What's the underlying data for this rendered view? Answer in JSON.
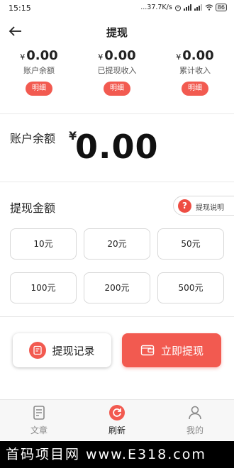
{
  "status_bar": {
    "time": "15:15",
    "network_speed": "...37.7K/s",
    "battery": "86"
  },
  "header": {
    "title": "提现"
  },
  "stats": [
    {
      "currency": "¥",
      "value": "0.00",
      "label": "账户余额",
      "button": "明细"
    },
    {
      "currency": "¥",
      "value": "0.00",
      "label": "已提现收入",
      "button": "明细"
    },
    {
      "currency": "¥",
      "value": "0.00",
      "label": "累计收入",
      "button": "明细"
    }
  ],
  "balance": {
    "label": "账户余额",
    "currency": "¥",
    "value": "0.00"
  },
  "amount_section": {
    "title": "提现金额",
    "help_label": "提现说明",
    "help_icon_text": "?",
    "options": [
      "10元",
      "20元",
      "50元",
      "100元",
      "200元",
      "500元"
    ]
  },
  "actions": {
    "records_label": "提现记录",
    "withdraw_label": "立即提现"
  },
  "tab_bar": {
    "items": [
      {
        "label": "文章",
        "icon": "article-icon"
      },
      {
        "label": "刷新",
        "icon": "refresh-icon",
        "active": true
      },
      {
        "label": "我的",
        "icon": "profile-icon"
      }
    ]
  },
  "footer": {
    "banner_text": "首码项目网  www.E318.com"
  },
  "colors": {
    "accent": "#f25a50",
    "text": "#222222",
    "muted": "#8a8a8a"
  }
}
